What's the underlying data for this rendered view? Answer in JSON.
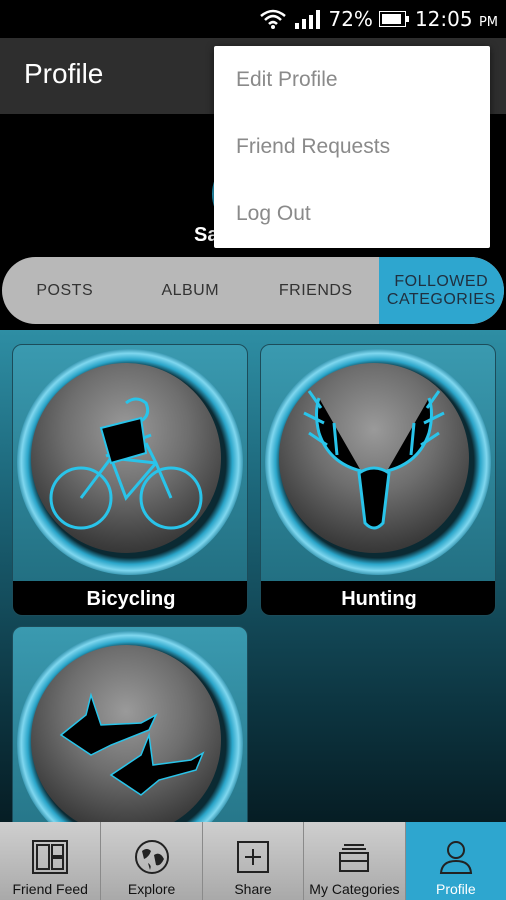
{
  "status_bar": {
    "battery_percent": "72%",
    "time": "12:05",
    "ampm": "PM"
  },
  "header": {
    "title": "Profile"
  },
  "profile": {
    "name_visible": "Sa"
  },
  "tabs": [
    {
      "label": "POSTS",
      "active": false
    },
    {
      "label": "ALBUM",
      "active": false
    },
    {
      "label": "FRIENDS",
      "active": false
    },
    {
      "label": "FOLLOWED CATEGORIES",
      "active": true
    }
  ],
  "categories": [
    {
      "label": "Bicycling",
      "icon": "bicycle-icon"
    },
    {
      "label": "Hunting",
      "icon": "deer-skull-icon"
    },
    {
      "label": "",
      "icon": "flying-ducks-icon"
    }
  ],
  "overflow_menu": {
    "items": [
      "Edit Profile",
      "Friend Requests",
      "Log Out"
    ]
  },
  "bottom_nav": [
    {
      "label": "Friend Feed",
      "icon": "feed-icon",
      "active": false
    },
    {
      "label": "Explore",
      "icon": "globe-icon",
      "active": false
    },
    {
      "label": "Share",
      "icon": "plus-square-icon",
      "active": false
    },
    {
      "label": "My Categories",
      "icon": "categories-icon",
      "active": false
    },
    {
      "label": "Profile",
      "icon": "person-icon",
      "active": true
    }
  ],
  "colors": {
    "accent": "#2ea6cf",
    "action_bar": "#2e2e2e",
    "tab_bg": "#b8b8b8"
  }
}
